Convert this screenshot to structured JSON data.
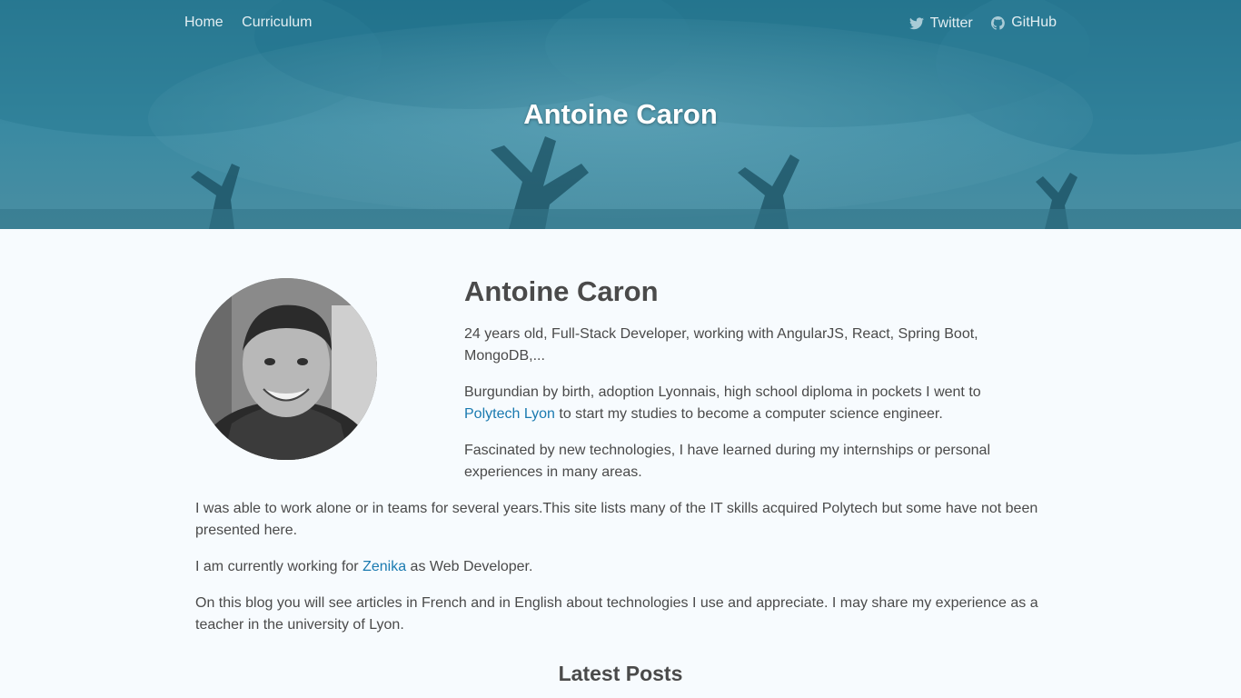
{
  "nav": {
    "left_items": [
      "Home",
      "Curriculum"
    ],
    "right_items": [
      {
        "label": "Twitter",
        "icon": "twitter-icon"
      },
      {
        "label": "GitHub",
        "icon": "github-icon"
      }
    ]
  },
  "hero": {
    "title": "Antoine Caron"
  },
  "about": {
    "heading": "Antoine Caron",
    "p1": "24 years old, Full-Stack Developer, working with AngularJS, React, Spring Boot, MongoDB,...",
    "p2_before": "Burgundian by birth, adoption Lyonnais, high school diploma in pockets I went to ",
    "p2_link": "Polytech Lyon",
    "p2_after": " to start my studies to become a computer science engineer.",
    "p3": "Fascinated by new technologies, I have learned during my internships or personal experiences in many areas.",
    "p4": "I was able to work alone or in teams for several years.This site lists many of the IT skills acquired Polytech but some have not been presented here.",
    "p5_before": "I am currently working for ",
    "p5_link": "Zenika",
    "p5_after": " as Web Developer.",
    "p6": "On this blog you will see articles in French and in English about technologies I use and appreciate. I may share my experience as a teacher in the university of Lyon."
  },
  "latest": {
    "heading": "Latest Posts"
  },
  "colors": {
    "hero_tint": "#1d6a80",
    "link": "#1a7ab0",
    "page_bg": "#f7fbfe",
    "text": "#4a4a4a"
  }
}
